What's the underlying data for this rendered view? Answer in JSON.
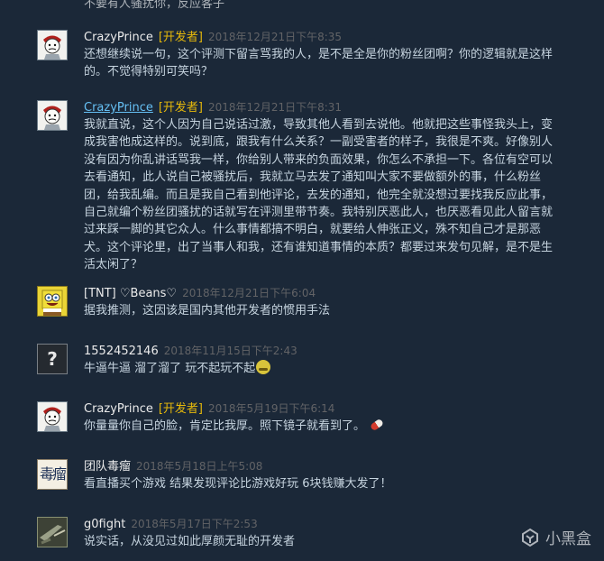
{
  "top_cut_text": "不要有人骚扰你，反应客子",
  "comments": [
    {
      "author": "CrazyPrince",
      "badge": "[开发者]",
      "timestamp": "2018年12月21日下午8:35",
      "text": "还想继续说一句，这个评测下留言骂我的人，是不是全是你的粉丝团啊？你的逻辑就是这样的。不觉得特别可笑吗？"
    },
    {
      "author": "CrazyPrince",
      "badge": "[开发者]",
      "timestamp": "2018年12月21日下午8:31",
      "text": "我就直说，这个人因为自己说话过激，导致其他人看到去说他。他就把这些事怪我头上，变成我害他成这样的。说到底，跟我有什么关系？一副受害者的样子，我很是不爽。好像别人没有因为你乱讲话骂我一样，你给别人带来的负面效果，你怎么不承担一下。各位有空可以去看通知，此人说自己被骚扰后，我就立马去发了通知叫大家不要做额外的事，什么粉丝团，给我乱编。而且是我自己看到他评论，去发的通知，他完全就没想过要找我反应此事，自己就编个粉丝团骚扰的话就写在评测里带节奏。我特别厌恶此人，也厌恶看见此人留言就过来踩一脚的其它众人。什么事情都搞不明白，就要给人伸张正义，殊不知自己才是那恶犬。这个评论里，出了当事人和我，还有谁知道事情的本质？都要过来发句见解，是不是生活太闲了？"
    },
    {
      "author": "[TNT] ♡Beans♡",
      "badge": "",
      "timestamp": "2018年12月21日下午6:04",
      "text": "据我推测，这因该是国内其他开发者的惯用手法"
    },
    {
      "author": "1552452146",
      "badge": "",
      "timestamp": "2018年11月15日下午2:43",
      "text": "牛逼牛逼 溜了溜了 玩不起玩不起"
    },
    {
      "author": "CrazyPrince",
      "badge": "[开发者]",
      "timestamp": "2018年5月19日下午6:14",
      "text": "你量量你自己的脸，肯定比我厚。照下镜子就看到了。"
    },
    {
      "author": "团队毒瘤",
      "badge": "",
      "timestamp": "2018年5月18日上午5:08",
      "text": "看直播买个游戏 结果发现评论比游戏好玩 6块钱赚大发了！"
    },
    {
      "author": "g0fight",
      "badge": "",
      "timestamp": "2018年5月17日下午2:53",
      "text": "说实话，从没见过如此厚颜无耻的开发者"
    }
  ],
  "avatars": {
    "q_glyph": "?",
    "team_glyph": "毒瘤"
  },
  "watermark": {
    "text": "小黑盒"
  }
}
